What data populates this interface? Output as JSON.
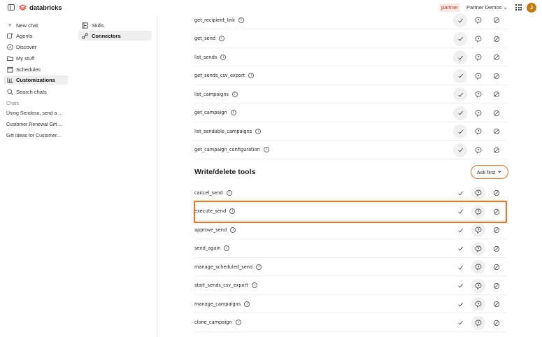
{
  "header": {
    "brand": "databricks",
    "badge": "partner",
    "workspace": "Partner Demos ⌄",
    "avatar_initial": "J",
    "brand_color": "#ff3621",
    "avatar_color": "#c27c0e"
  },
  "sidebar": {
    "items": [
      {
        "label": "New chat",
        "icon": "plus-icon"
      },
      {
        "label": "Agents",
        "icon": "agents-icon"
      },
      {
        "label": "Discover",
        "icon": "compass-icon"
      },
      {
        "label": "My stuff",
        "icon": "folder-icon"
      },
      {
        "label": "Schedules",
        "icon": "calendar-icon"
      },
      {
        "label": "Customizations",
        "icon": "customizations-icon"
      },
      {
        "label": "Search chats",
        "icon": "search-icon"
      }
    ],
    "chats_label": "Chats",
    "chats": [
      "Using Sendoso, send a ...",
      "Customer Renewal Gift ...",
      "Gift Ideas for Customer..."
    ]
  },
  "subnav": {
    "items": [
      {
        "label": "Skills",
        "icon": "skills-icon"
      },
      {
        "label": "Connectors",
        "icon": "connectors-icon"
      }
    ]
  },
  "read_tools": [
    "get_recipient_link",
    "get_send",
    "list_sends",
    "get_sends_csv_export",
    "list_campaigns",
    "get_campaign",
    "list_sendable_campaigns",
    "get_campaign_configuration"
  ],
  "write_section": {
    "title": "Write/delete tools",
    "policy": "Ask first",
    "accent_color": "#e8742a"
  },
  "write_tools": [
    "cancel_send",
    "execute_send",
    "approve_send",
    "send_again",
    "manage_scheduled_send",
    "start_sends_csv_export",
    "manage_campaigns",
    "clone_campaign"
  ]
}
